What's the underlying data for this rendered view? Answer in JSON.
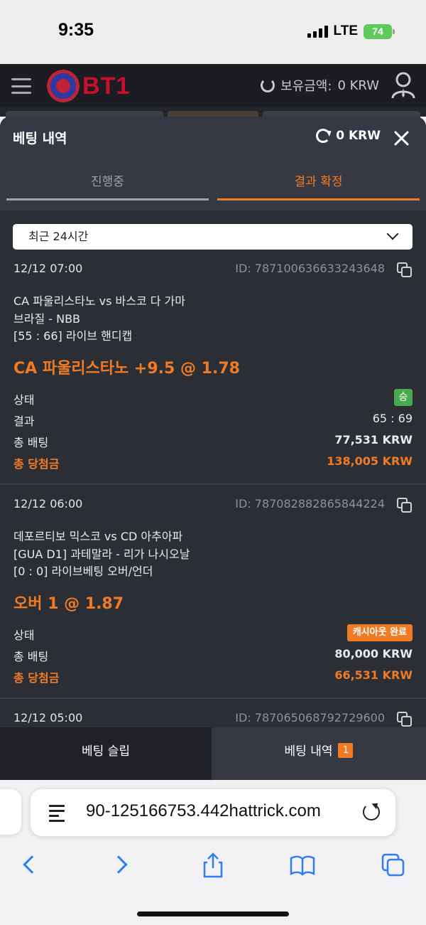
{
  "status_bar": {
    "time": "9:35",
    "network": "LTE",
    "battery": "74"
  },
  "site_header": {
    "logo": "BT1",
    "balance_label": "보유금액:",
    "balance_value": "0 KRW"
  },
  "modal": {
    "title": "베팅 내역",
    "balance": "0 KRW",
    "tabs": [
      {
        "label": "진행중",
        "active": false
      },
      {
        "label": "결과 확정",
        "active": true
      }
    ],
    "filter": {
      "selected": "최근 24시간"
    }
  },
  "bets": [
    {
      "date": "12/12 07:00",
      "id": "ID: 787100636633243648",
      "match": "CA 파울리스타노 vs 바스코 다 가마",
      "league": "브라질 - NBB",
      "market": "[55 : 66] 라이브 핸디캡",
      "pick": "CA 파울리스타노 +9.5 @ 1.78",
      "status_label": "상태",
      "status_badge": "승",
      "result_label": "결과",
      "result_value": "65 : 69",
      "stake_label": "총 배팅",
      "stake_value": "77,531 KRW",
      "payout_label": "총 당첨금",
      "payout_value": "138,005 KRW"
    },
    {
      "date": "12/12 06:00",
      "id": "ID: 787082882865844224",
      "match": "데포르티보 믹스코 vs CD 아추아파",
      "league": "[GUA D1] 과테말라 - 리가 나시오날",
      "market": "[0 : 0] 라이브베팅 오버/언더",
      "pick": "오버 1 @ 1.87",
      "status_label": "상태",
      "status_badge": "캐시아웃 완료",
      "stake_label": "총 배팅",
      "stake_value": "80,000 KRW",
      "payout_label": "총 당첨금",
      "payout_value": "66,531 KRW"
    },
    {
      "date": "12/12 05:00",
      "id": "ID: 787065068792729600"
    }
  ],
  "bottom_tabs": {
    "slip_label": "베팅 슬립",
    "history_label": "베팅 내역",
    "history_count": "1"
  },
  "safari": {
    "url": "90-125166753.442hattrick.com"
  },
  "colors": {
    "accent": "#f07b24",
    "win": "#4aa84e",
    "modal_bg": "#2b2e35",
    "header_bg": "#363943",
    "safari_blue": "#2f7cf6"
  }
}
